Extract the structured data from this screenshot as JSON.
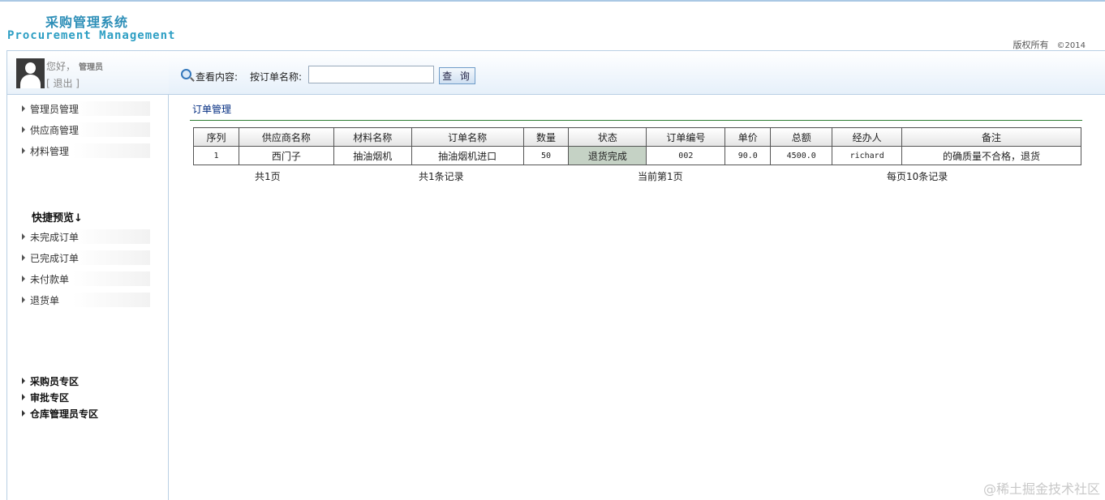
{
  "header": {
    "title_cn": "采购管理系统",
    "title_en": "Procurement Management",
    "copyright": "版权所有",
    "year": "©2014"
  },
  "user": {
    "greeting": "您好，",
    "role": "管理员",
    "logout": "[ 退出 ]"
  },
  "search": {
    "label": "查看内容:",
    "field_label": "按订单名称:",
    "value": "",
    "button": "查 询"
  },
  "sidebar": {
    "menu": [
      {
        "label": "管理员管理"
      },
      {
        "label": "供应商管理"
      },
      {
        "label": "材料管理"
      }
    ],
    "quick_title": "快捷预览↓",
    "quick": [
      {
        "label": "未完成订单"
      },
      {
        "label": "已完成订单"
      },
      {
        "label": "未付款单"
      },
      {
        "label": "退货单"
      }
    ],
    "zones": [
      {
        "label": "采购员专区"
      },
      {
        "label": "审批专区"
      },
      {
        "label": "仓库管理员专区"
      }
    ]
  },
  "main": {
    "title": "订单管理",
    "columns": [
      "序列",
      "供应商名称",
      "材料名称",
      "订单名称",
      "数量",
      "状态",
      "订单编号",
      "单价",
      "总额",
      "经办人",
      "备注"
    ],
    "rows": [
      [
        "1",
        "西门子",
        "抽油烟机",
        "抽油烟机进口",
        "50",
        "退货完成",
        "002",
        "90.0",
        "4500.0",
        "richard",
        "的确质量不合格，退货"
      ]
    ],
    "pager": {
      "total_pages": "共1页",
      "total_records": "共1条记录",
      "current": "当前第1页",
      "per_page": "每页10条记录"
    }
  },
  "watermark": "@稀土掘金技术社区",
  "colors": {
    "brand": "#2e8fb8",
    "title_rule": "#2e7d32",
    "status_cell": "#c5d2c5"
  }
}
